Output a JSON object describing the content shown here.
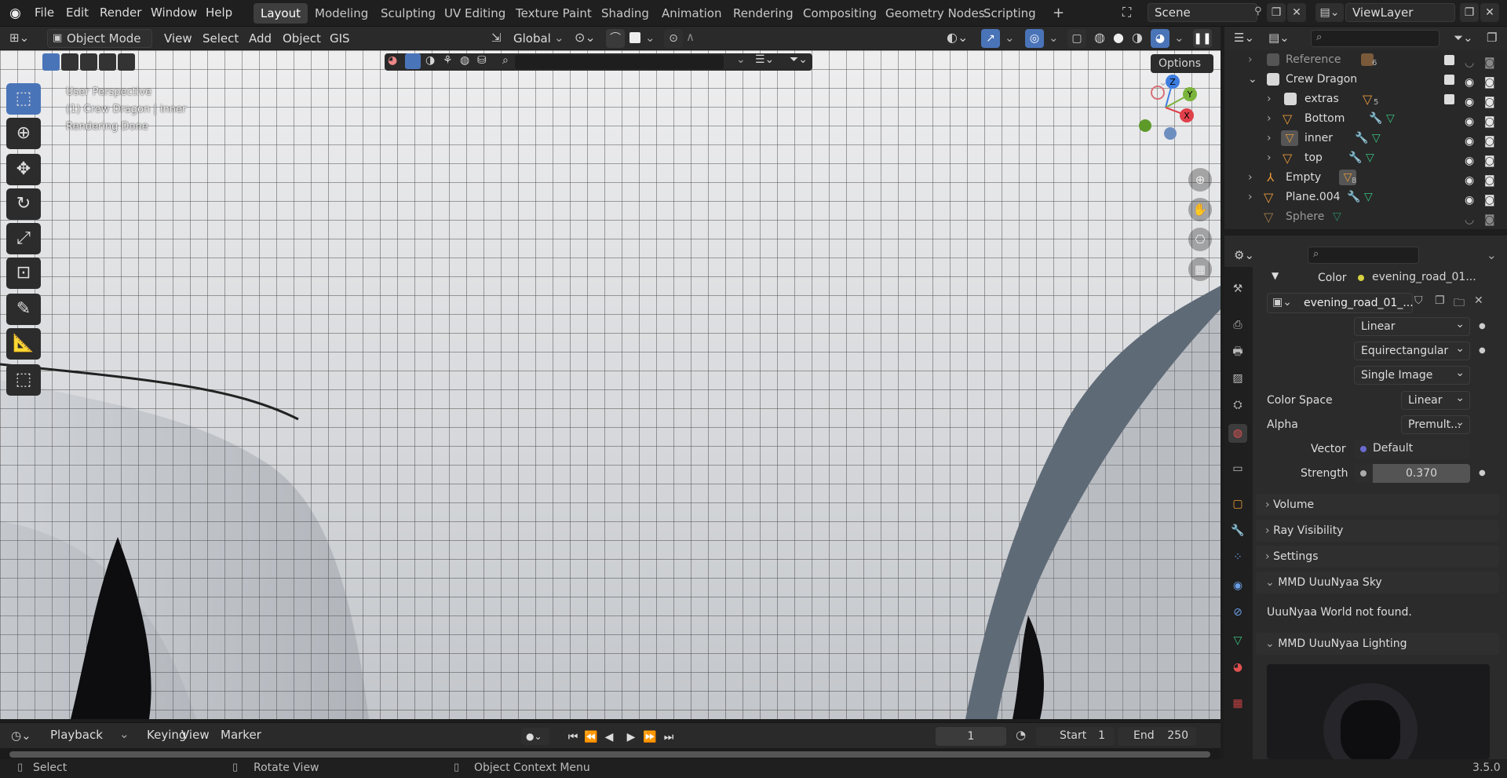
{
  "menu": [
    "File",
    "Edit",
    "Render",
    "Window",
    "Help"
  ],
  "workspaces": [
    "Layout",
    "Modeling",
    "Sculpting",
    "UV Editing",
    "Texture Paint",
    "Shading",
    "Animation",
    "Rendering",
    "Compositing",
    "Geometry Nodes",
    "Scripting"
  ],
  "workspace_add": "+",
  "scene": "Scene",
  "view_layer": "ViewLayer",
  "viewport_header": {
    "mode": "Object Mode",
    "menus": [
      "View",
      "Select",
      "Add",
      "Object",
      "GIS"
    ],
    "transform_orientation": "Global",
    "options": "Options"
  },
  "overlay": {
    "line1": "User Perspective",
    "line2": "(1) Crew Dragon | inner",
    "line3": "Rendering Done"
  },
  "gizmo": {
    "z": "Z",
    "y": "Y",
    "x": "X"
  },
  "outliner": [
    {
      "name": "Reference",
      "count": "6",
      "dim": true
    },
    {
      "name": "Crew Dragon"
    },
    {
      "name": "extras",
      "count": "5"
    },
    {
      "name": "Bottom"
    },
    {
      "name": "inner"
    },
    {
      "name": "top"
    },
    {
      "name": "Empty",
      "count": "8"
    },
    {
      "name": "Plane.004"
    },
    {
      "name": "Sphere",
      "dim": true
    }
  ],
  "properties": {
    "color_label": "Color",
    "color_value": "evening_road_01...",
    "image_name": "evening_road_01_...",
    "interpolation": "Linear",
    "projection": "Equirectangular",
    "source": "Single Image",
    "color_space_label": "Color Space",
    "color_space": "Linear",
    "alpha_label": "Alpha",
    "alpha": "Premult...",
    "vector_label": "Vector",
    "vector": "Default",
    "strength_label": "Strength",
    "strength": "0.370",
    "panels": [
      "Volume",
      "Ray Visibility",
      "Settings"
    ],
    "mmd_sky": "MMD UuuNyaa Sky",
    "mmd_sky_msg": "UuuNyaa World not found.",
    "mmd_lighting": "MMD UuuNyaa Lighting"
  },
  "timeline": {
    "menus": [
      "Playback",
      "Keying",
      "View",
      "Marker"
    ],
    "current_frame": "1",
    "start_label": "Start",
    "start": "1",
    "end_label": "End",
    "end": "250"
  },
  "status": {
    "select": "Select",
    "rotate": "Rotate View",
    "context": "Object Context Menu",
    "version": "3.5.0"
  }
}
